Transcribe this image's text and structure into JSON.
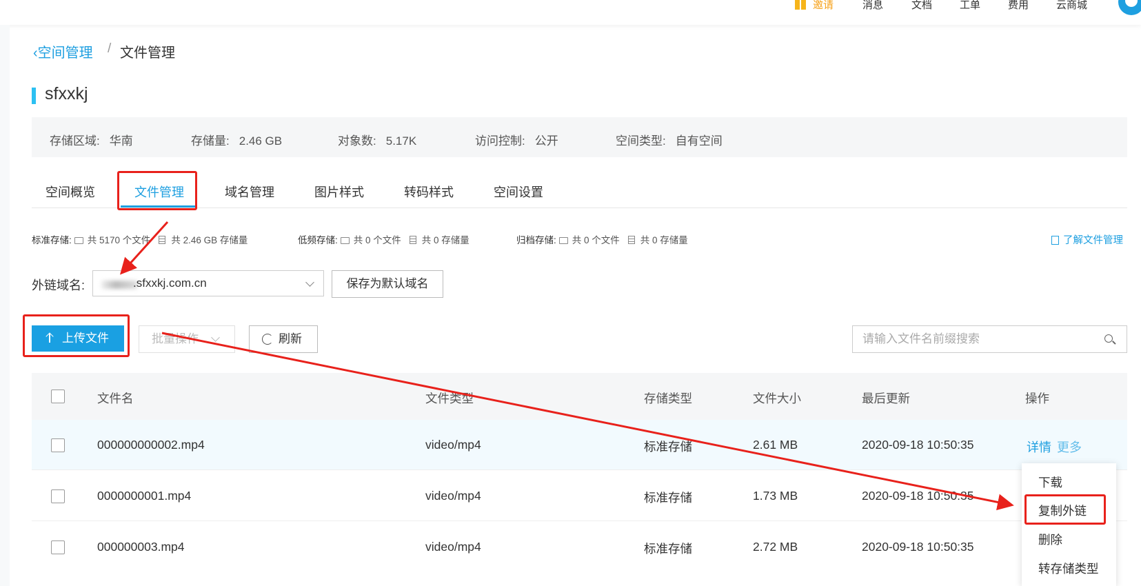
{
  "topnav": {
    "invite": "邀请",
    "messages": "消息",
    "docs": "文档",
    "tickets": "工单",
    "billing": "费用",
    "marketplace": "云商城"
  },
  "breadcrumb": {
    "parent": "空间管理",
    "separator": "/",
    "current": "文件管理"
  },
  "bucket": {
    "name": "sfxxkj"
  },
  "info": {
    "region_label": "存储区域:",
    "region_value": "华南",
    "storage_label": "存储量:",
    "storage_value": "2.46 GB",
    "objects_label": "对象数:",
    "objects_value": "5.17K",
    "access_label": "访问控制:",
    "access_value": "公开",
    "type_label": "空间类型:",
    "type_value": "自有空间"
  },
  "tabs": [
    "空间概览",
    "文件管理",
    "域名管理",
    "图片样式",
    "转码样式",
    "空间设置"
  ],
  "stats": {
    "standard_label": "标准存储:",
    "standard_files": "共 5170 个文件",
    "standard_size": "共 2.46 GB 存储量",
    "infrequent_label": "低频存储:",
    "infrequent_files": "共 0 个文件",
    "infrequent_size": "共 0 存储量",
    "archive_label": "归档存储:",
    "archive_files": "共 0 个文件",
    "archive_size": "共 0 存储量",
    "learn_link": "了解文件管理"
  },
  "domain": {
    "label": "外链域名:",
    "value": ".sfxxkj.com.cn",
    "save_default": "保存为默认域名"
  },
  "actions": {
    "upload": "上传文件",
    "batch": "批量操作",
    "refresh": "刷新",
    "search_placeholder": "请输入文件名前缀搜索"
  },
  "table": {
    "headers": {
      "name": "文件名",
      "type": "文件类型",
      "storage": "存储类型",
      "size": "文件大小",
      "updated": "最后更新",
      "ops": "操作"
    },
    "rows": [
      {
        "name": "000000000002.mp4",
        "type": "video/mp4",
        "storage": "标准存储",
        "size": "2.61 MB",
        "updated": "2020-09-18 10:50:35"
      },
      {
        "name": "0000000001.mp4",
        "type": "video/mp4",
        "storage": "标准存储",
        "size": "1.73 MB",
        "updated": "2020-09-18 10:50:35"
      },
      {
        "name": "000000003.mp4",
        "type": "video/mp4",
        "storage": "标准存储",
        "size": "2.72 MB",
        "updated": "2020-09-18 10:50:35"
      }
    ],
    "op_detail": "详情",
    "op_more": "更多"
  },
  "more_menu": [
    "下载",
    "复制外链",
    "删除",
    "转存储类型"
  ],
  "colors": {
    "accent": "#1e9fe0",
    "title_bar": "#2cc0f2",
    "annotation": "#e8211b"
  }
}
